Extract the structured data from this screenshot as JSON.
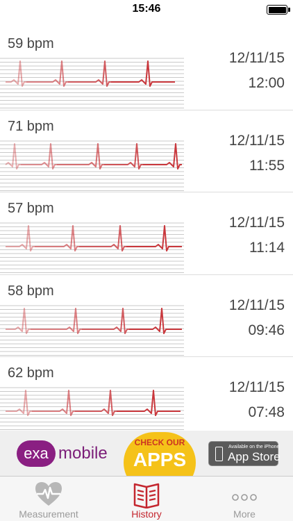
{
  "status_bar": {
    "time": "15:46"
  },
  "measurements": [
    {
      "bpm": "59 bpm",
      "date": "12/11/15",
      "time": "12:00"
    },
    {
      "bpm": "71 bpm",
      "date": "12/11/15",
      "time": "11:55"
    },
    {
      "bpm": "57 bpm",
      "date": "12/11/15",
      "time": "11:14"
    },
    {
      "bpm": "58 bpm",
      "date": "12/11/15",
      "time": "09:46"
    },
    {
      "bpm": "62 bpm",
      "date": "12/11/15",
      "time": "07:48"
    }
  ],
  "ad_banner": {
    "brand_short": "exa",
    "brand_rest": "mobile",
    "promo_small": "CHECK OUR",
    "promo_big": "APPS",
    "store_small": "Available on the iPhone",
    "store_big": "App Store"
  },
  "tab_bar": {
    "tabs": [
      {
        "label": "Measurement",
        "icon": "heart-icon",
        "active": false
      },
      {
        "label": "History",
        "icon": "book-icon",
        "active": true
      },
      {
        "label": "More",
        "icon": "more-dots-icon",
        "active": false
      }
    ]
  },
  "colors": {
    "accent": "#c4262e",
    "ecg_trace": "#c9373c",
    "grid": "#c9c9c9"
  }
}
